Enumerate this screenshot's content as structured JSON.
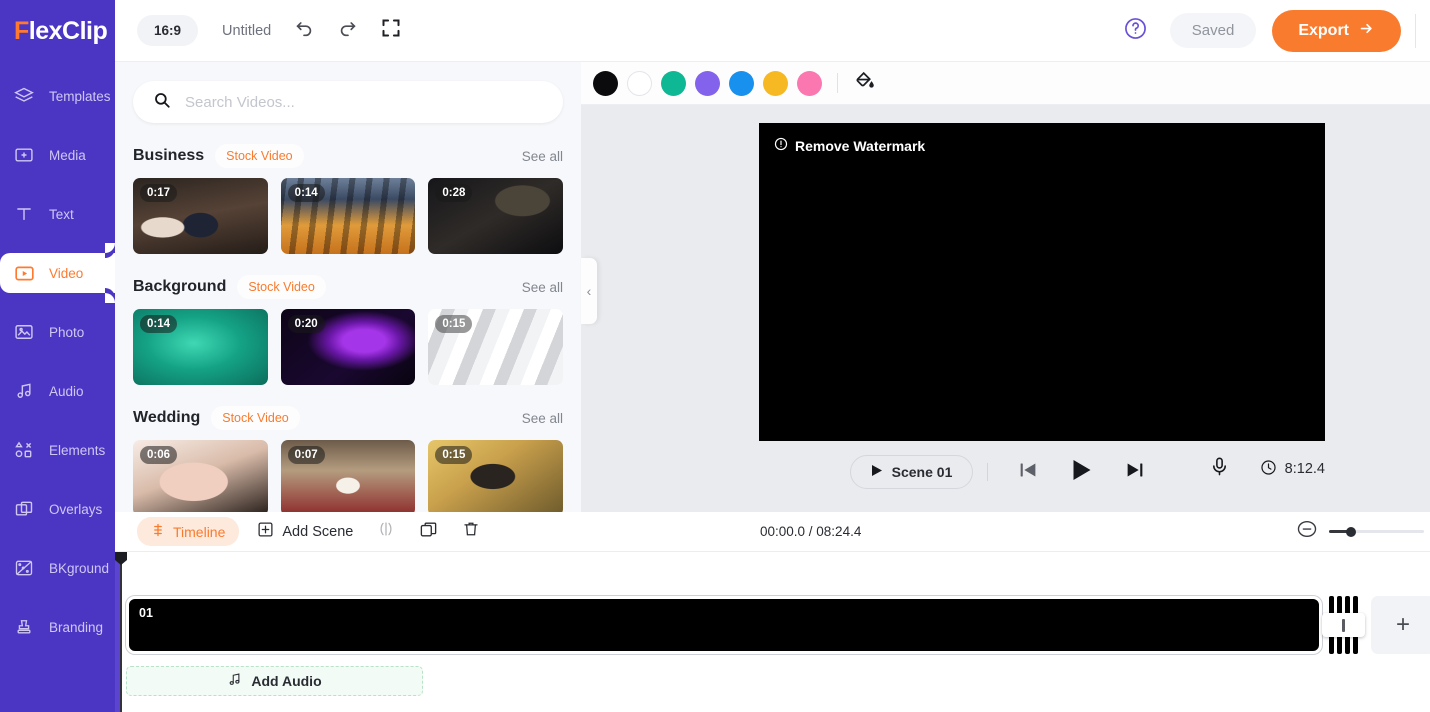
{
  "brand": {
    "logo_f": "F",
    "logo_rest": "lexClip",
    "accent": "#f97b2e",
    "sidebar_bg": "#4b36c4"
  },
  "sidebar": {
    "items": [
      {
        "label": "Templates",
        "icon": "layers-icon",
        "active": false
      },
      {
        "label": "Media",
        "icon": "media-folder-icon",
        "active": false
      },
      {
        "label": "Text",
        "icon": "text-icon",
        "active": false
      },
      {
        "label": "Video",
        "icon": "video-icon",
        "active": true
      },
      {
        "label": "Photo",
        "icon": "photo-icon",
        "active": false
      },
      {
        "label": "Audio",
        "icon": "audio-note-icon",
        "active": false
      },
      {
        "label": "Elements",
        "icon": "elements-icon",
        "active": false
      },
      {
        "label": "Overlays",
        "icon": "overlays-icon",
        "active": false
      },
      {
        "label": "BKground",
        "icon": "background-icon",
        "active": false
      },
      {
        "label": "Branding",
        "icon": "branding-stamp-icon",
        "active": false
      }
    ]
  },
  "header": {
    "aspect_ratio": "16:9",
    "project_title": "Untitled",
    "undo_icon": "undo-icon",
    "redo_icon": "redo-icon",
    "fullscreen_icon": "fullscreen-icon",
    "help_icon": "help-circle-icon",
    "saved_label": "Saved",
    "export_label": "Export",
    "export_arrow": "→"
  },
  "search": {
    "placeholder": "Search Videos...",
    "value": "",
    "icon": "search-icon"
  },
  "panel": {
    "see_all_label": "See all",
    "badge_label": "Stock Video",
    "sections": [
      {
        "title": "Business",
        "badge": "Stock Video",
        "see_all": "See all",
        "items": [
          {
            "duration": "0:17",
            "art": "t-b1"
          },
          {
            "duration": "0:14",
            "art": "t-b2"
          },
          {
            "duration": "0:28",
            "art": "t-b3"
          }
        ]
      },
      {
        "title": "Background",
        "badge": "Stock Video",
        "see_all": "See all",
        "items": [
          {
            "duration": "0:14",
            "art": "t-g1"
          },
          {
            "duration": "0:20",
            "art": "t-g2"
          },
          {
            "duration": "0:15",
            "art": "t-g3"
          }
        ]
      },
      {
        "title": "Wedding",
        "badge": "Stock Video",
        "see_all": "See all",
        "items": [
          {
            "duration": "0:06",
            "art": "t-w1"
          },
          {
            "duration": "0:07",
            "art": "t-w2"
          },
          {
            "duration": "0:15",
            "art": "t-w3"
          }
        ]
      }
    ],
    "collapse_icon": "chevron-left-icon"
  },
  "colorbar": {
    "swatches": [
      {
        "name": "black",
        "hex": "#0b0b0d"
      },
      {
        "name": "white",
        "hex": "#ffffff"
      },
      {
        "name": "teal",
        "hex": "#0fb894"
      },
      {
        "name": "purple",
        "hex": "#8362ec"
      },
      {
        "name": "blue",
        "hex": "#1790ee"
      },
      {
        "name": "amber",
        "hex": "#f7b923"
      },
      {
        "name": "pink",
        "hex": "#fb77af"
      }
    ],
    "bucket_icon": "paint-bucket-icon"
  },
  "preview": {
    "watermark_label": "Remove Watermark",
    "watermark_icon": "info-circle-icon",
    "scene_label": "Scene 01",
    "scene_play_icon": "play-icon",
    "prev_icon": "skip-back-icon",
    "play_icon": "play-icon",
    "next_icon": "skip-forward-icon",
    "mic_icon": "microphone-icon",
    "clock_icon": "clock-icon",
    "duration": "8:12.4"
  },
  "timeline_bar": {
    "timeline_label": "Timeline",
    "timeline_icon": "timeline-icon",
    "add_scene_label": "Add Scene",
    "add_scene_icon": "plus-box-icon",
    "split_icon": "split-icon",
    "duplicate_icon": "duplicate-icon",
    "delete_icon": "trash-icon",
    "time_display": "00:00.0 / 08:24.4",
    "zoom_out_icon": "zoom-out-icon",
    "zoom_value": 20
  },
  "timeline": {
    "clip_label": "01",
    "transition_icon": "transition-handle-icon",
    "add_clip_label": "+",
    "add_audio_label": "Add Audio",
    "add_audio_icon": "music-note-icon",
    "playhead_position": "00:00.0"
  }
}
